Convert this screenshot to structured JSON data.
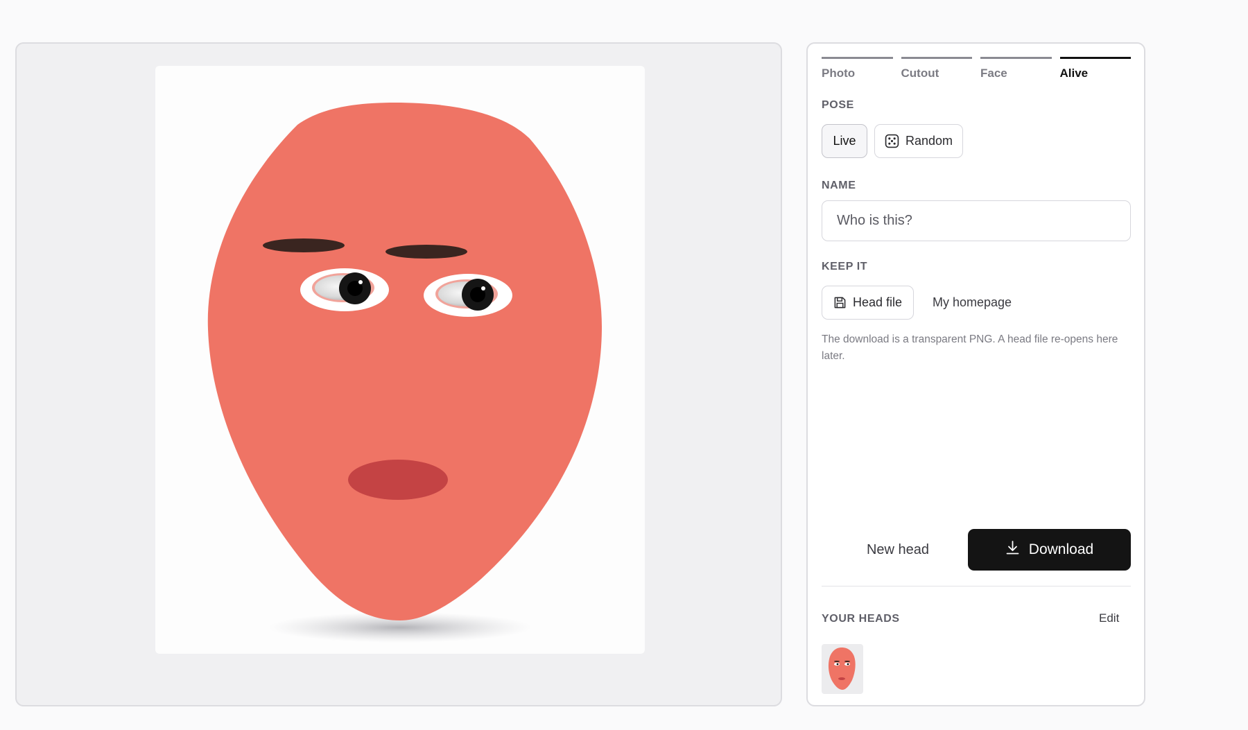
{
  "stage": {
    "face_icon": "red-egg-head-face",
    "colors": {
      "skin": "#ef7465",
      "lips": "#c44344",
      "brows": "#3a2520",
      "background": "#f0f0f2"
    }
  },
  "panel": {
    "steps": [
      {
        "label": "Photo",
        "active": false
      },
      {
        "label": "Cutout",
        "active": false
      },
      {
        "label": "Face",
        "active": false
      },
      {
        "label": "Alive",
        "active": true
      }
    ],
    "pose": {
      "label": "POSE",
      "live_label": "Live",
      "random_label": "Random",
      "random_icon": "dice-icon",
      "selected": "Live"
    },
    "name": {
      "label": "NAME",
      "placeholder": "Who is this?",
      "value": ""
    },
    "keep": {
      "label": "KEEP IT",
      "head_file_label": "Head file",
      "head_file_icon": "floppy-disk-icon",
      "homepage_label": "My homepage",
      "hint": "The download is a transparent PNG. A head file re-opens here later."
    },
    "actions": {
      "new_head_label": "New head",
      "download_label": "Download",
      "download_icon": "download-arrow-icon",
      "download_color": "#141414"
    },
    "your_heads": {
      "label": "YOUR HEADS",
      "edit_label": "Edit",
      "count": 1
    }
  }
}
